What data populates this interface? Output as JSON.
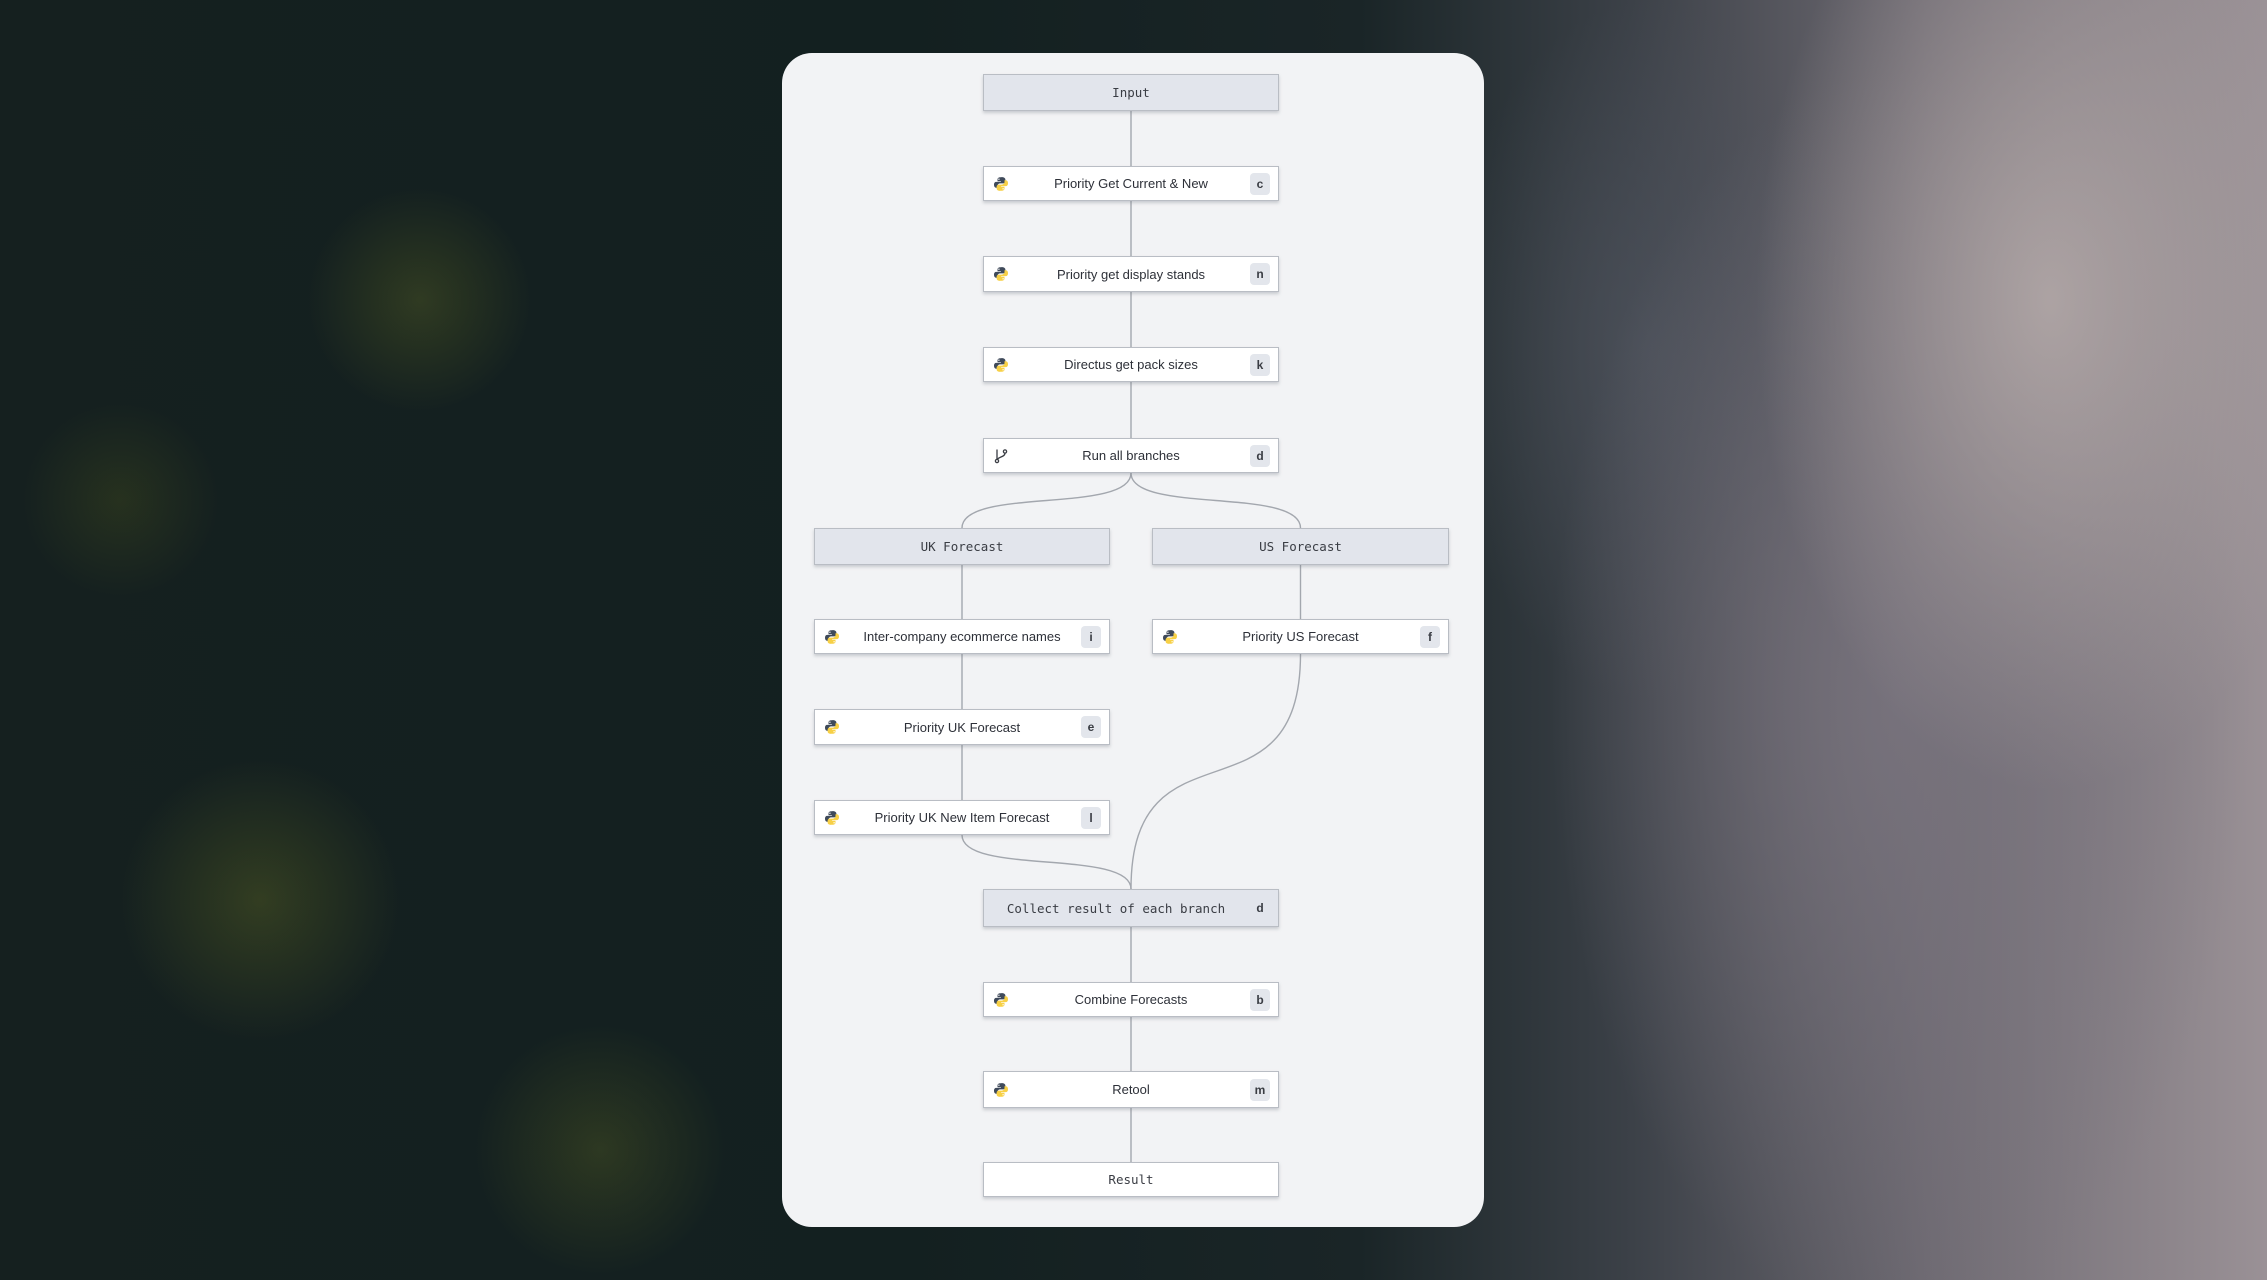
{
  "flow": {
    "nodes": [
      {
        "id": "input",
        "label": "Input",
        "kind": "group",
        "icon": null,
        "badge": null
      },
      {
        "id": "c",
        "label": "Priority Get Current & New",
        "kind": "step",
        "icon": "python-icon",
        "badge": "c"
      },
      {
        "id": "n",
        "label": "Priority get display stands",
        "kind": "step",
        "icon": "python-icon",
        "badge": "n"
      },
      {
        "id": "k",
        "label": "Directus get pack sizes",
        "kind": "step",
        "icon": "python-icon",
        "badge": "k"
      },
      {
        "id": "d",
        "label": "Run all branches",
        "kind": "step",
        "icon": "branch-icon",
        "badge": "d"
      },
      {
        "id": "uk",
        "label": "UK Forecast",
        "kind": "group",
        "icon": null,
        "badge": null
      },
      {
        "id": "us",
        "label": "US Forecast",
        "kind": "group",
        "icon": null,
        "badge": null
      },
      {
        "id": "i",
        "label": "Inter-company ecommerce names",
        "kind": "step",
        "icon": "python-icon",
        "badge": "i"
      },
      {
        "id": "f",
        "label": "Priority US Forecast",
        "kind": "step",
        "icon": "python-icon",
        "badge": "f"
      },
      {
        "id": "e",
        "label": "Priority UK Forecast",
        "kind": "step",
        "icon": "python-icon",
        "badge": "e"
      },
      {
        "id": "l",
        "label": "Priority UK New Item Forecast",
        "kind": "step",
        "icon": "python-icon",
        "badge": "l"
      },
      {
        "id": "collect",
        "label": "Collect result of each branch",
        "kind": "group",
        "icon": null,
        "badge": "d"
      },
      {
        "id": "b",
        "label": "Combine Forecasts",
        "kind": "step",
        "icon": "python-icon",
        "badge": "b"
      },
      {
        "id": "m",
        "label": "Retool",
        "kind": "step",
        "icon": "python-icon",
        "badge": "m"
      },
      {
        "id": "result",
        "label": "Result",
        "kind": "plain",
        "icon": null,
        "badge": null
      }
    ],
    "edges": [
      [
        "input",
        "c"
      ],
      [
        "c",
        "n"
      ],
      [
        "n",
        "k"
      ],
      [
        "k",
        "d"
      ],
      [
        "d",
        "uk"
      ],
      [
        "d",
        "us"
      ],
      [
        "uk",
        "i"
      ],
      [
        "i",
        "e"
      ],
      [
        "e",
        "l"
      ],
      [
        "us",
        "f"
      ],
      [
        "l",
        "collect"
      ],
      [
        "f",
        "collect"
      ],
      [
        "collect",
        "b"
      ],
      [
        "b",
        "m"
      ],
      [
        "m",
        "result"
      ]
    ]
  },
  "colors": {
    "card_bg": "#f2f3f5",
    "group_node_bg": "#e2e5ec",
    "step_node_bg": "#ffffff",
    "badge_bg": "#e3e6ec",
    "edge": "#a3a7ae",
    "python_blue": "#3f4a5a",
    "python_yellow": "#f7d046"
  }
}
